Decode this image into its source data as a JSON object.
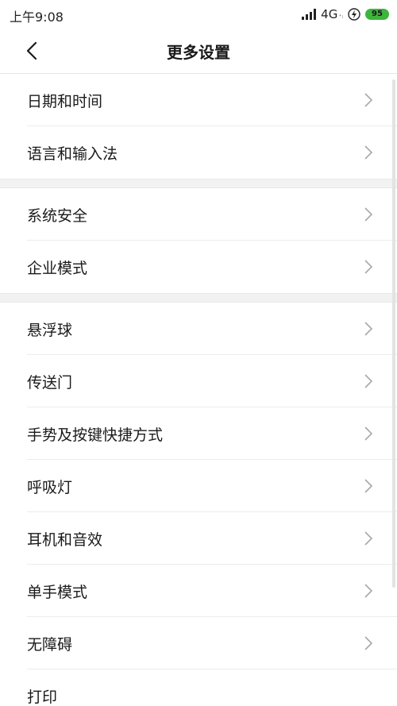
{
  "status_bar": {
    "time": "上午9:08",
    "network": "4G",
    "network_sub": "⁺ᵢ",
    "battery": "95",
    "battery_color": "#3db53d"
  },
  "header": {
    "title": "更多设置"
  },
  "groups": [
    {
      "items": [
        {
          "label": "日期和时间"
        },
        {
          "label": "语言和输入法"
        }
      ]
    },
    {
      "items": [
        {
          "label": "系统安全"
        },
        {
          "label": "企业模式"
        }
      ]
    },
    {
      "items": [
        {
          "label": "悬浮球"
        },
        {
          "label": "传送门"
        },
        {
          "label": "手势及按键快捷方式"
        },
        {
          "label": "呼吸灯"
        },
        {
          "label": "耳机和音效"
        },
        {
          "label": "单手模式"
        },
        {
          "label": "无障碍"
        },
        {
          "label": "打印"
        }
      ]
    }
  ]
}
